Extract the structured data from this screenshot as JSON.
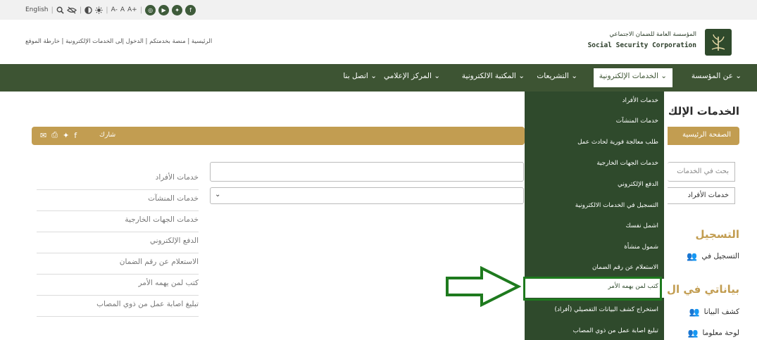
{
  "topbar": {
    "language": "English",
    "font_small": "A-",
    "font_normal": "A",
    "font_large": "A+"
  },
  "header": {
    "links": "الرئيسية | منصة بخدمتكم | الدخول إلى الخدمات الإلكترونية | خارطة الموقع",
    "org_name_ar": "المؤسسة العامة للضمان الاجتماعي",
    "org_name_en": "Social Security Corporation"
  },
  "nav": {
    "items": [
      "عن المؤسسة",
      "الخدمات الإلكترونية",
      "التشريعات",
      "المكتبة الالكترونية",
      "المركز الإعلامي",
      "اتصل بنا"
    ]
  },
  "dropdown": {
    "items": [
      "خدمات الأفراد",
      "خدمات المنشآت",
      "طلب معالجة فورية لحادث عمل",
      "خدمات الجهات الخارجية",
      "الدفع الإلكتروني",
      "التسجيل في الخدمات الالكترونية",
      "اشمل نفسك",
      "شمول منشأة",
      "الاستعلام عن رقم الضمان",
      "كتب لمن يهمه الأمر",
      "استخراج كشف البيانات التفصيلي (أفراد)",
      "تبليغ اصابة عمل من ذوي المصاب"
    ]
  },
  "page": {
    "title": "الخدمات الإلك",
    "breadcrumb": "الصفحة الرئيسية",
    "share_label": "شارك"
  },
  "sidebar": {
    "items": [
      "خدمات الأفراد",
      "خدمات المنشآت",
      "خدمات الجهات الخارجية",
      "الدفع الإلكتروني",
      "الاستعلام عن رقم الضمان",
      "كتب لمن يهمه الأمر",
      "تبليغ اصابة عمل من ذوي المصاب"
    ]
  },
  "search": {
    "placeholder_partial": "بحث في الخدمات",
    "select_value": "خدمات الأفراد"
  },
  "sections": {
    "registration_heading": "التسجيل",
    "registration_item": "التسجيل في",
    "mydata_heading": "بياناتي في ال",
    "mydata_item_1": "كشف البيانا",
    "mydata_item_2": "لوحة معلوما"
  }
}
